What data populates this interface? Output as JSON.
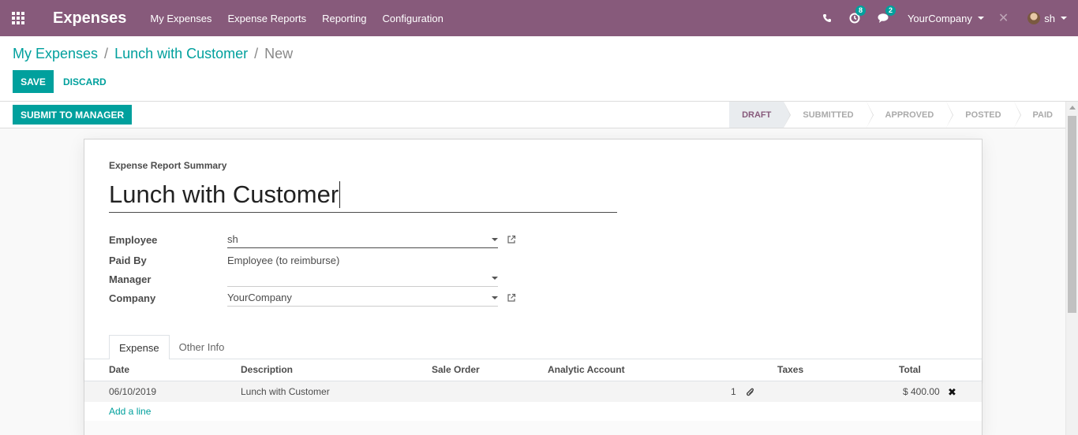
{
  "navbar": {
    "brand": "Expenses",
    "menu": [
      "My Expenses",
      "Expense Reports",
      "Reporting",
      "Configuration"
    ],
    "activities_count": "8",
    "messages_count": "2",
    "company": "YourCompany",
    "user": "sh",
    "bg_color": "#875a7b"
  },
  "breadcrumb": {
    "root": "My Expenses",
    "parent": "Lunch with Customer",
    "current": "New"
  },
  "buttons": {
    "save": "SAVE",
    "discard": "DISCARD",
    "submit": "SUBMIT TO MANAGER"
  },
  "statusbar": {
    "stages": [
      "DRAFT",
      "SUBMITTED",
      "APPROVED",
      "POSTED",
      "PAID"
    ],
    "active": "DRAFT"
  },
  "form": {
    "summary_label": "Expense Report Summary",
    "title": "Lunch with Customer",
    "fields": {
      "employee_label": "Employee",
      "employee_value": "sh",
      "paid_by_label": "Paid By",
      "paid_by_value": "Employee (to reimburse)",
      "manager_label": "Manager",
      "manager_value": "",
      "company_label": "Company",
      "company_value": "YourCompany"
    }
  },
  "tabs": [
    "Expense",
    "Other Info"
  ],
  "table": {
    "columns": [
      "Date",
      "Description",
      "Sale Order",
      "Analytic Account",
      "Taxes",
      "Total"
    ],
    "rows": [
      {
        "date": "06/10/2019",
        "description": "Lunch with Customer",
        "attachments": "1",
        "total": "$ 400.00"
      }
    ],
    "add_line": "Add a line"
  },
  "colors": {
    "primary": "#00a09d",
    "brand": "#875a7b"
  }
}
